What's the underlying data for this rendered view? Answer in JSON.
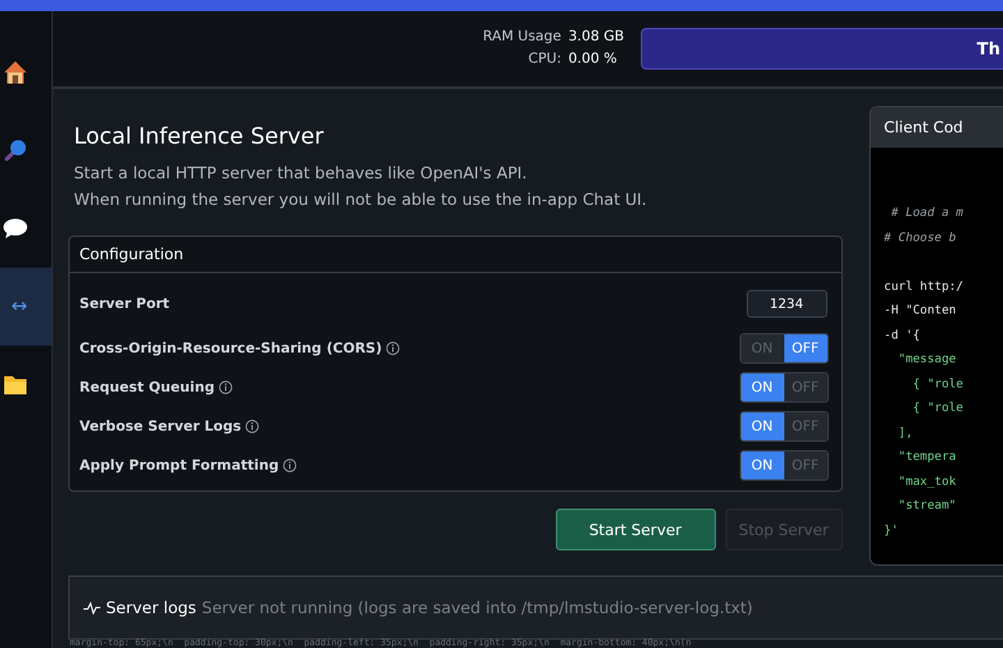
{
  "sidebar": {
    "items": [
      {
        "kind": "house",
        "selected": false
      },
      {
        "kind": "magnifier",
        "selected": false
      },
      {
        "kind": "chat",
        "selected": false
      },
      {
        "kind": "glyph",
        "glyph": "↔",
        "selected": true
      },
      {
        "kind": "folder",
        "selected": false
      }
    ]
  },
  "header": {
    "ram_label": "RAM Usage",
    "ram_value": "3.08 GB",
    "cpu_label": "CPU:",
    "cpu_value": "0.00 %",
    "banner_text": "Th"
  },
  "title": "Local Inference Server",
  "description": [
    "Start a local HTTP server that behaves like OpenAI's API.",
    "When running the server you will not be able to use the in-app Chat UI."
  ],
  "configuration": {
    "title": "Configuration",
    "rows": [
      {
        "kind": "port",
        "label": "Server Port",
        "value": "1234"
      },
      {
        "kind": "toggle",
        "label": "Cross-Origin-Resource-Sharing (CORS)",
        "info": true,
        "on": false,
        "on_label": "ON",
        "off_label": "OFF"
      },
      {
        "kind": "toggle",
        "label": "Request Queuing",
        "info": true,
        "on": true,
        "on_label": "ON",
        "off_label": "OFF"
      },
      {
        "kind": "toggle",
        "label": "Verbose Server Logs",
        "info": true,
        "on": true,
        "on_label": "ON",
        "off_label": "OFF"
      },
      {
        "kind": "toggle",
        "label": "Apply Prompt Formatting",
        "info": true,
        "on": true,
        "on_label": "ON",
        "off_label": "OFF"
      }
    ]
  },
  "buttons": [
    {
      "label": "Start Server",
      "disabled": false
    },
    {
      "label": "Stop Server",
      "disabled": true
    }
  ],
  "client_code": {
    "title": "Client Cod",
    "lines": [
      {
        "kind": "comment",
        "text": " # Load a m"
      },
      {
        "kind": "comment",
        "text": "# Choose b"
      },
      {
        "kind": "blank"
      },
      {
        "kind": "plain",
        "text": "curl http:/"
      },
      {
        "kind": "plain",
        "text": "-H \"Conten"
      },
      {
        "kind": "plain",
        "text": "-d '{"
      },
      {
        "kind": "string",
        "text": "  \"message"
      },
      {
        "kind": "string",
        "text": "    { \"role"
      },
      {
        "kind": "string",
        "text": "    { \"role"
      },
      {
        "kind": "string",
        "text": "  ],"
      },
      {
        "kind": "string",
        "text": "  \"tempera"
      },
      {
        "kind": "string",
        "text": "  \"max_tok"
      },
      {
        "kind": "string",
        "text": "  \"stream\""
      },
      {
        "kind": "string",
        "text": "}'"
      }
    ]
  },
  "server_logs": {
    "title": "Server logs",
    "status": "Server not running (logs are saved into /tmp/lmstudio-server-log.txt)",
    "log_line": "margin-top: 65px;\\n  padding-top: 30px;\\n  padding-left: 35px;\\n  padding-right: 35px;\\n  margin-bottom: 40px;\\n(n"
  }
}
